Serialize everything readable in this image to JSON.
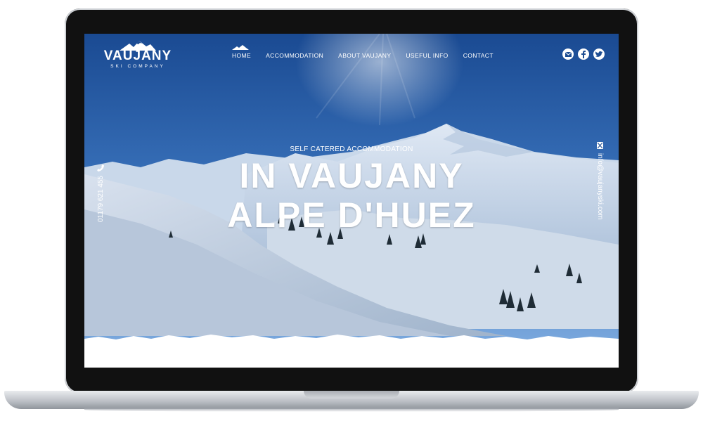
{
  "brand": {
    "name": "VAUJANY",
    "subtitle": "SKI COMPANY"
  },
  "nav": {
    "items": [
      {
        "label": "HOME"
      },
      {
        "label": "ACCOMMODATION"
      },
      {
        "label": "ABOUT VAUJANY"
      },
      {
        "label": "USEFUL INFO"
      },
      {
        "label": "CONTACT"
      }
    ]
  },
  "social": {
    "icons": [
      "mail-icon",
      "facebook-icon",
      "twitter-icon"
    ]
  },
  "hero": {
    "tagline": "SELF CATERED ACCOMMODATION",
    "headline_line1": "IN VAUJANY",
    "headline_line2": "ALPE D'HUEZ"
  },
  "contact": {
    "phone": "01179 621 455",
    "email": "info@vaujanyski.com"
  },
  "colors": {
    "sky_top": "#1a4a92",
    "sky_bottom": "#6d9fd8",
    "snow": "#e9eef5",
    "text": "#ffffff"
  }
}
